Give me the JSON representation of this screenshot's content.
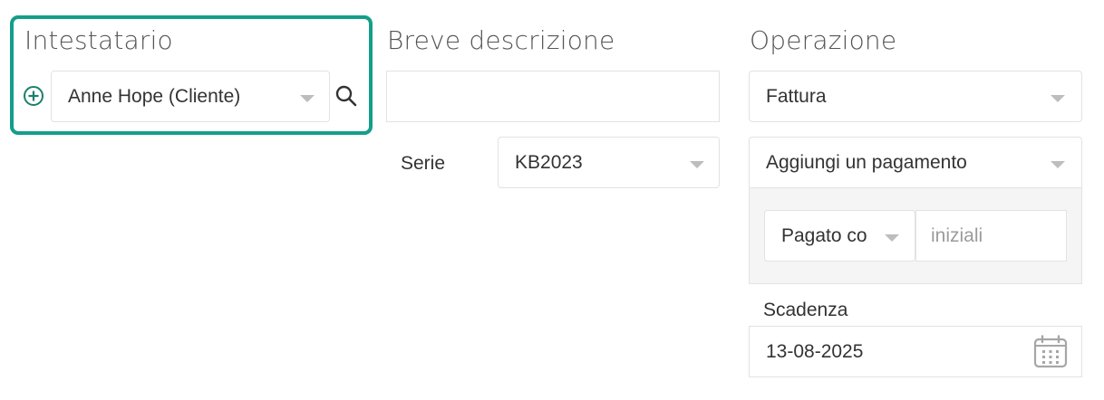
{
  "intestatario": {
    "title": "Intestatario",
    "client_value": "Anne Hope (Cliente)",
    "add_icon": "plus-circle-icon",
    "search_icon": "search-icon"
  },
  "descrizione": {
    "title": "Breve descrizione",
    "value": ""
  },
  "serie": {
    "label": "Serie",
    "value": "KB2023"
  },
  "operazione": {
    "title": "Operazione",
    "type_value": "Fattura",
    "payment_value": "Aggiungi un pagamento",
    "paid_with_value": "Pagato co",
    "initials_placeholder": "iniziali"
  },
  "scadenza": {
    "label": "Scadenza",
    "date_value": "13-08-2025",
    "calendar_icon": "calendar-icon"
  },
  "colors": {
    "accent": "#149e8a",
    "add_icon": "#1a7f6e",
    "border": "#e2e2e2",
    "panel_bg": "#f5f5f5"
  }
}
